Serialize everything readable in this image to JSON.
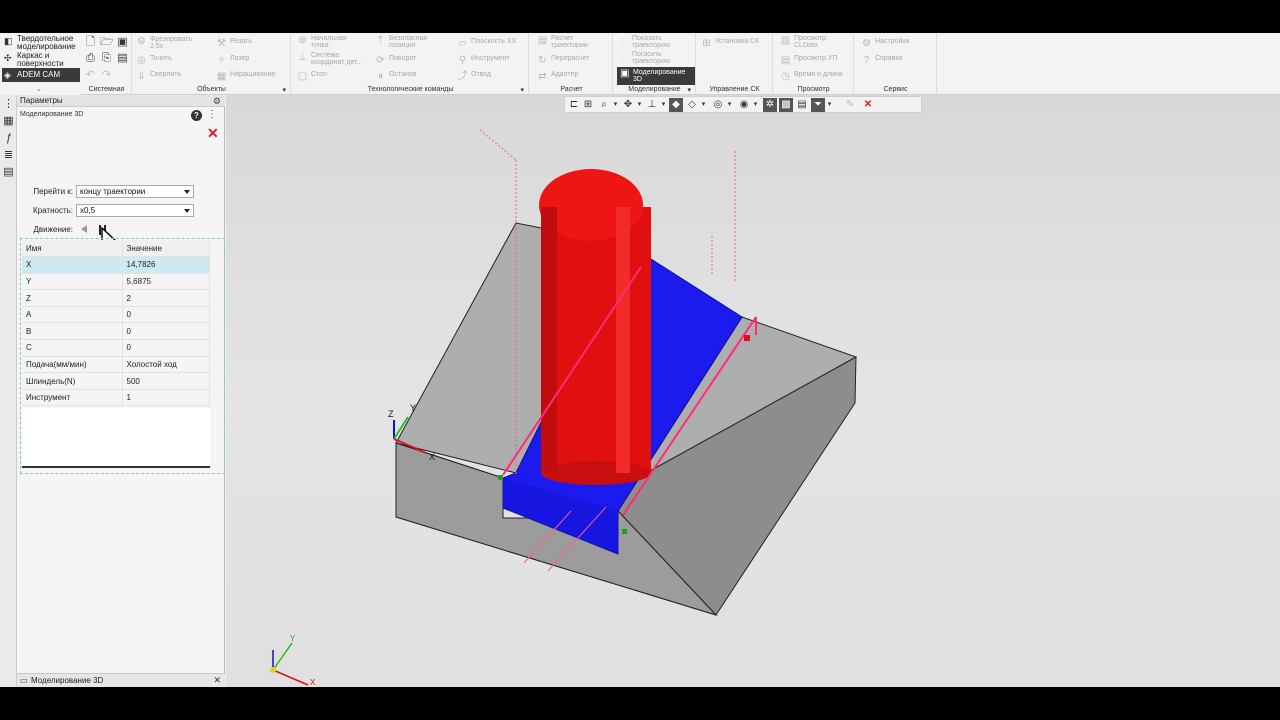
{
  "ribbon": {
    "modes": [
      {
        "label": "Твердотельное моделирование",
        "icon": "cube-icon"
      },
      {
        "label": "Каркас и поверхности",
        "icon": "wireframe-icon"
      },
      {
        "label": "ADEM CAM",
        "icon": "cam-icon",
        "active": true
      }
    ],
    "groups": {
      "system": "Системная",
      "objects": "Объекты",
      "tech_commands": "Технологические команды",
      "calc": "Расчет",
      "modeling": "Моделирование",
      "cs_control": "Управление СК",
      "view": "Просмотр",
      "service": "Сервис"
    },
    "objects_items": {
      "mill_25x": "Фрезеровать 2.5x",
      "cut": "Резать",
      "turn": "Точить",
      "laser": "Лазер",
      "drill": "Сверлить",
      "buildup": "Наращивание"
    },
    "tech_items": {
      "start_point": "Начальная точка",
      "safe_pos": "Безопасная позиция",
      "xx_plane": "Плоскость XX",
      "coord_system": "Система координат дет...",
      "rotate": "Поворот",
      "tool": "Инструмент",
      "stop": "Стоп",
      "halt": "Останов",
      "retract": "Отвод"
    },
    "calc_items": {
      "calc_traj": "Расчет траектории",
      "recalc": "Перерасчет",
      "adapter": "Адаптер"
    },
    "modeling_items": {
      "show_traj": "Показать траекторию",
      "hide_traj": "Погасить траекторию",
      "modeling_3d": "Моделирование 3D"
    },
    "cs_items": {
      "set_cs": "Установка СК"
    },
    "view_items": {
      "view_cldata": "Просмотр CLData",
      "view_nc": "Просмотр УП",
      "time_length": "Время и длина"
    },
    "service_items": {
      "settings": "Настройки",
      "help": "Справка"
    }
  },
  "panel": {
    "title": "Параметры",
    "subtitle": "Моделирование 3D",
    "goto_label": "Перейти к:",
    "goto_value": "концу траектории",
    "multiplicity_label": "Кратность:",
    "multiplicity_value": "x0,5",
    "motion_label": "Движение:",
    "table": {
      "headers": [
        "Имя",
        "Значение"
      ],
      "rows": [
        [
          "X",
          "14,7826"
        ],
        [
          "Y",
          "5,6875"
        ],
        [
          "Z",
          "2"
        ],
        [
          "A",
          "0"
        ],
        [
          "B",
          "0"
        ],
        [
          "C",
          "0"
        ],
        [
          "Подача(мм/мин)",
          "Холостой ход"
        ],
        [
          "Шпиндель(N)",
          "500"
        ],
        [
          "Инструмент",
          "1"
        ]
      ],
      "selected_row": 0
    }
  },
  "bottom_tab": {
    "label": "Моделирование 3D"
  },
  "axes": {
    "x": "X",
    "y": "Y",
    "z": "Z"
  },
  "colors": {
    "tool": "#e01010",
    "pocket": "#1010ee",
    "stock": "#a8a8a8",
    "path": "#ff2a7a",
    "active": "#3a3a3a"
  }
}
